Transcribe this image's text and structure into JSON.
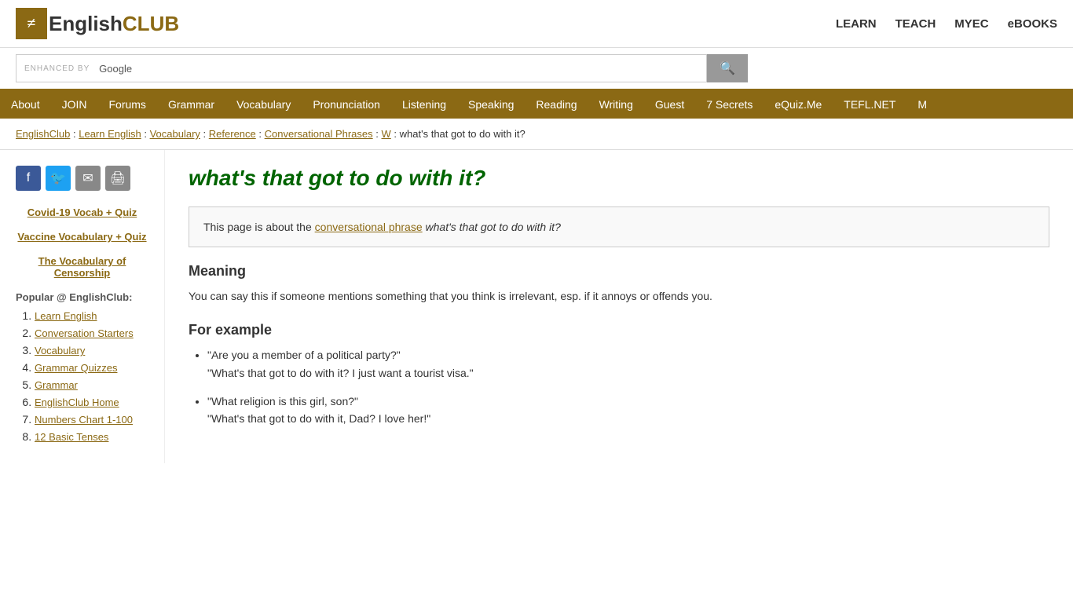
{
  "header": {
    "logo_english": "English",
    "logo_club": "CLUB",
    "nav": {
      "learn": "LEARN",
      "teach": "TEACH",
      "myec": "MYEC",
      "ebooks": "eBOOKS"
    }
  },
  "search": {
    "enhanced_by": "ENHANCED BY",
    "google": "Google",
    "placeholder": "",
    "button_icon": "🔍"
  },
  "navbar": {
    "items": [
      "About",
      "JOIN",
      "Forums",
      "Grammar",
      "Vocabulary",
      "Pronunciation",
      "Listening",
      "Speaking",
      "Reading",
      "Writing",
      "Guest",
      "7 Secrets",
      "eQuiz.Me",
      "TEFL.NET",
      "M"
    ]
  },
  "breadcrumb": {
    "items": [
      "EnglishClub",
      "Learn English",
      "Vocabulary",
      "Reference",
      "Conversational Phrases",
      "W"
    ],
    "current": "what's that got to do with it?"
  },
  "sidebar": {
    "links": [
      "Covid-19 Vocab + Quiz",
      "Vaccine Vocabulary + Quiz",
      "The Vocabulary of Censorship"
    ],
    "popular_title": "Popular @ EnglishClub:",
    "popular_items": [
      "Learn English",
      "Conversation Starters",
      "Vocabulary",
      "Grammar Quizzes",
      "Grammar",
      "EnglishClub Home",
      "Numbers Chart 1-100",
      "12 Basic Tenses"
    ]
  },
  "content": {
    "phrase": "what's that got to do with it?",
    "intro": {
      "text_before": "This page is about the",
      "link_text": "conversational phrase",
      "phrase_italic": "what's that got to do with it?"
    },
    "meaning": {
      "title": "Meaning",
      "text": "You can say this if someone mentions something that you think is irrelevant, esp. if it annoys or offends you."
    },
    "for_example": {
      "title": "For example",
      "examples": [
        {
          "line1": "\"Are you a member of a political party?\"",
          "line2": "\"What's that got to do with it? I just want a tourist visa.\""
        },
        {
          "line1": "\"What religion is this girl, son?\"",
          "line2": "\"What's that got to do with it, Dad? I love her!\""
        }
      ]
    }
  }
}
